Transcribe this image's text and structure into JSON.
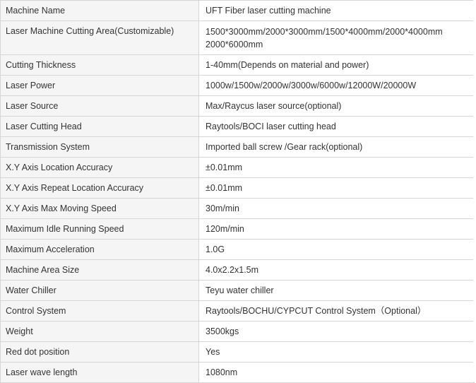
{
  "specs": [
    {
      "label": "Machine Name",
      "value": "UFT Fiber laser cutting machine"
    },
    {
      "label": "Laser Machine Cutting Area(Customizable)",
      "value": "1500*3000mm/2000*3000mm/1500*4000mm/2000*4000mm\n2000*6000mm"
    },
    {
      "label": "Cutting Thickness",
      "value": "1-40mm(Depends on material and power)"
    },
    {
      "label": "Laser Power",
      "value": "1000w/1500w/2000w/3000w/6000w/12000W/20000W"
    },
    {
      "label": "Laser Source",
      "value": "Max/Raycus laser source(optional)"
    },
    {
      "label": "Laser Cutting Head",
      "value": "Raytools/BOCI laser cutting head"
    },
    {
      "label": "Transmission System",
      "value": "Imported ball screw /Gear rack(optional)"
    },
    {
      "label": "X.Y Axis Location Accuracy",
      "value": "±0.01mm"
    },
    {
      "label": "X.Y Axis Repeat Location Accuracy",
      "value": "±0.01mm"
    },
    {
      "label": "X.Y Axis Max Moving Speed",
      "value": "30m/min"
    },
    {
      "label": "Maximum Idle Running Speed",
      "value": "120m/min"
    },
    {
      "label": "Maximum Acceleration",
      "value": "1.0G"
    },
    {
      "label": "Machine Area Size",
      "value": "4.0x2.2x1.5m"
    },
    {
      "label": "Water Chiller",
      "value": "Teyu water chiller"
    },
    {
      "label": "Control System",
      "value": "Raytools/BOCHU/CYPCUT Control System（Optional）"
    },
    {
      "label": "Weight",
      "value": "3500kgs"
    },
    {
      "label": "Red dot position",
      "value": "Yes"
    },
    {
      "label": "Laser wave length",
      "value": "1080nm"
    }
  ]
}
